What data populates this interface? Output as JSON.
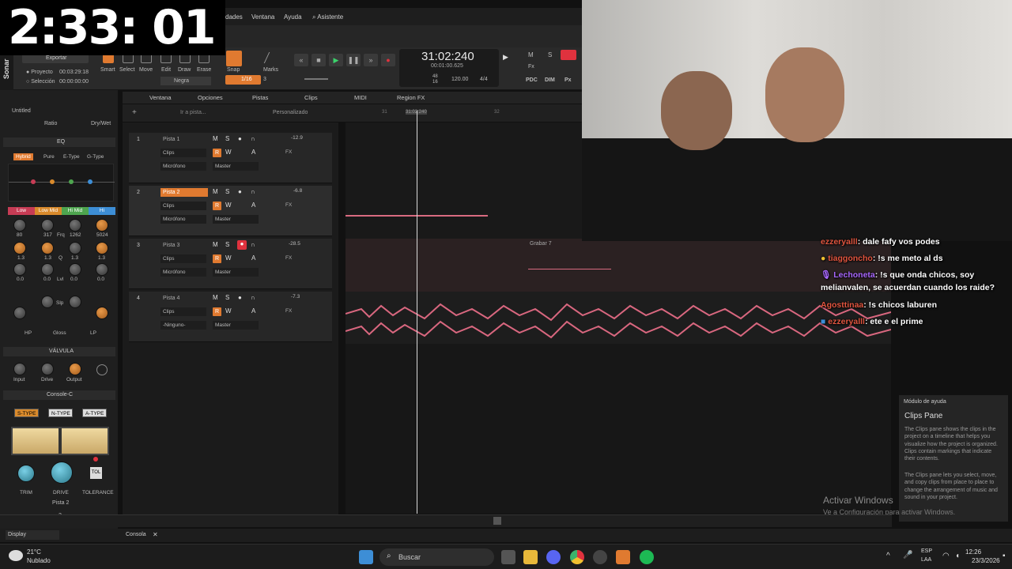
{
  "timer": "2:33: 01",
  "menu": {
    "items": [
      "dades",
      "Ventana",
      "Ayuda",
      "Asistente"
    ]
  },
  "project": {
    "exportar": "Exportar",
    "proyecto_label": "Proyecto",
    "proyecto_time": "00:03:29:18",
    "seleccion_label": "Selección",
    "seleccion_time": "00:00:00:00",
    "app_name": "Sonar"
  },
  "tools": {
    "labels": [
      "Smart",
      "Select",
      "Move",
      "Edit",
      "Draw",
      "Erase"
    ],
    "color": "Negra",
    "snap": "Snap",
    "snap_value": "1/16",
    "snap_count": "3",
    "marks": "Marks"
  },
  "transport": {
    "timecode": "31:02:240",
    "timecode_sub": "00:01:00.625",
    "bar_a": "48",
    "bar_b": "16",
    "tempo": "120.00",
    "meter": "4/4",
    "m_label": "M",
    "s_label": "S",
    "pdc": "PDC",
    "dim": "DIM",
    "fx": "Fx",
    "px": "Px"
  },
  "view_menu": {
    "items": [
      "Ventana",
      "Opciones",
      "Pistas",
      "Clips",
      "MIDI",
      "Region FX"
    ],
    "goto": "Ir a pista...",
    "preset": "Personalizado",
    "ruler": [
      "31",
      "31:02:240",
      "32"
    ]
  },
  "inspector": {
    "untitled": "Untitled",
    "ratio": "Ratio",
    "drywet": "Dry/Wet",
    "eq_title": "EQ",
    "eq_modes": [
      "Hybrid",
      "Pure",
      "E-Type",
      "G-Type"
    ],
    "bands": [
      "Low",
      "Low Mid",
      "Hi Mid",
      "Hi"
    ],
    "band_colors": [
      "#c73c55",
      "#d98a2c",
      "#4ea54f",
      "#3d8ed6"
    ],
    "freqs": [
      "80",
      "317",
      "Frq",
      "1262",
      "5024"
    ],
    "qs": [
      "1.3",
      "1.3",
      "Q",
      "1.3",
      "1.3"
    ],
    "gains": [
      "0.0",
      "0.0",
      "Lvl",
      "0.0",
      "0.0"
    ],
    "slp": "Slp",
    "filters": [
      "HP",
      "Gloss",
      "LP"
    ],
    "valve_title": "VÁLVULA",
    "valve_knobs": [
      "Input",
      "Drive",
      "Output"
    ],
    "console_title": "Console-C",
    "console_types": [
      "S-TYPE",
      "N-TYPE",
      "A-TYPE"
    ],
    "console_knobs": [
      "TRIM",
      "DRIVE",
      "TOLERANCE"
    ],
    "tol": "TOL",
    "track_name": "Pista 2",
    "track_num": "2"
  },
  "tracks": [
    {
      "num": "1",
      "name": "Pista 1",
      "clips": "Clips",
      "input": "Micrófono",
      "output": "Master",
      "vol": "-12.9",
      "fx": "FX"
    },
    {
      "num": "2",
      "name": "Pista 2",
      "clips": "Clips",
      "input": "Micrófono",
      "output": "Master",
      "vol": "-6.8",
      "fx": "FX"
    },
    {
      "num": "3",
      "name": "Pista 3",
      "clips": "Clips",
      "input": "Micrófono",
      "output": "Master",
      "vol": "-28.5",
      "fx": "FX"
    },
    {
      "num": "4",
      "name": "Pista 4",
      "clips": "Clips",
      "input": "-Ninguno-",
      "output": "Master",
      "vol": "-7.3",
      "fx": "FX"
    }
  ],
  "track_buttons": [
    "M",
    "S",
    "W",
    "A"
  ],
  "record_label": "R",
  "clip_name": "Grabar 7",
  "chat": [
    {
      "user": "ezzeryalll",
      "msg": ": dale fafy vos podes",
      "color": "#e0553f"
    },
    {
      "user": "tiaggoncho",
      "msg": ": !s me meto al ds",
      "color": "#e2553f"
    },
    {
      "user": "Lechoneta",
      "msg": ": !s que onda chicos, soy melianvalen, se acuerdan cuando los raide?",
      "color": "#a968ff"
    },
    {
      "user": "Agosttinaa",
      "msg": ": !s chicos laburen",
      "color": "#e2553f"
    },
    {
      "user": "ezzeryalll",
      "msg": ": ete e el prime",
      "color": "#e0553f"
    }
  ],
  "help": {
    "title": "Módulo de ayuda",
    "heading": "Clips Pane",
    "p1": "The Clips pane shows the clips in the project on a timeline that helps you visualize how the project is organized. Clips contain markings that indicate their contents.",
    "p2": "The Clips pane lets you select, move, and copy clips from place to place to change the arrangement of music and sound in your project."
  },
  "watermark": {
    "line1": "Activar Windows",
    "line2": "Ve a Configuración para activar Windows."
  },
  "bottom": {
    "display": "Display",
    "consola": "Consola"
  },
  "taskbar": {
    "temp": "21°C",
    "weather": "Nublado",
    "search": "Buscar",
    "lang1": "ESP",
    "lang2": "LAA",
    "time": "12:26",
    "date": "23/3/2026"
  }
}
